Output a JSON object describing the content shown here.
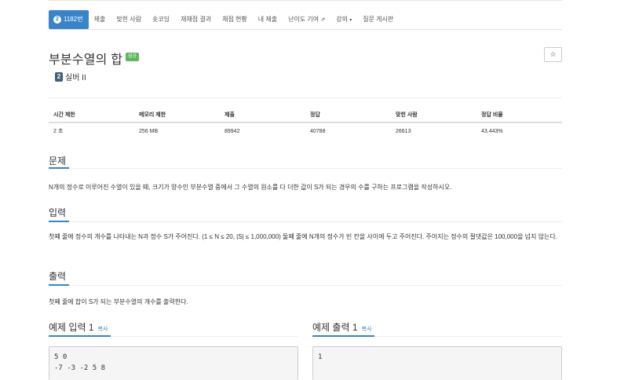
{
  "nav": {
    "problem_badge": "2",
    "problem_number": "1182번",
    "tabs": [
      {
        "label": "제출"
      },
      {
        "label": "맞힌 사람"
      },
      {
        "label": "숏코딩"
      },
      {
        "label": "재채점 결과"
      },
      {
        "label": "채점 현황"
      },
      {
        "label": "내 제출"
      },
      {
        "label": "난이도 기여",
        "icon": "external-link-icon",
        "icon_glyph": "⇗"
      },
      {
        "label": "강의",
        "icon": "caret-down-icon",
        "icon_glyph": "▾"
      },
      {
        "label": "질문 게시판"
      }
    ]
  },
  "problem": {
    "title": "부분수열의 합",
    "status": "성공",
    "star_glyph": "☆",
    "tier_badge": "2",
    "tier": "실버 II"
  },
  "info_table": {
    "headers": [
      "시간 제한",
      "메모리 제한",
      "제출",
      "정답",
      "맞힌 사람",
      "정답 비율"
    ],
    "values": [
      "2 초",
      "256 MB",
      "89942",
      "40788",
      "26613",
      "43.443%"
    ]
  },
  "sections": {
    "description_title": "문제",
    "description": "N개의 정수로 이루어진 수열이 있을 때, 크기가 양수인 부분수열 중에서 그 수열의 원소를 다 더한 값이 S가 되는 경우의 수를 구하는 프로그램을 작성하시오.",
    "input_title": "입력",
    "input": "첫째 줄에 정수의 개수를 나타내는 N과 정수 S가 주어진다. (1 ≤ N ≤ 20, |S| ≤ 1,000,000) 둘째 줄에 N개의 정수가 빈 칸을 사이에 두고 주어진다. 주어지는 정수의 절댓값은 100,000을 넘지 않는다.",
    "output_title": "출력",
    "output": "첫째 줄에 합이 S가 되는 부분수열의 개수를 출력한다."
  },
  "samples": {
    "input_title": "예제 입력 1",
    "output_title": "예제 출력 1",
    "copy_label": "복사",
    "input_line1": "5 0",
    "input_line2": "-7 -3 -2 5 8",
    "output_line1": "1"
  },
  "colors": {
    "accent": "#3784c9",
    "success": "#5cb85c",
    "tier": "#435f7a"
  }
}
